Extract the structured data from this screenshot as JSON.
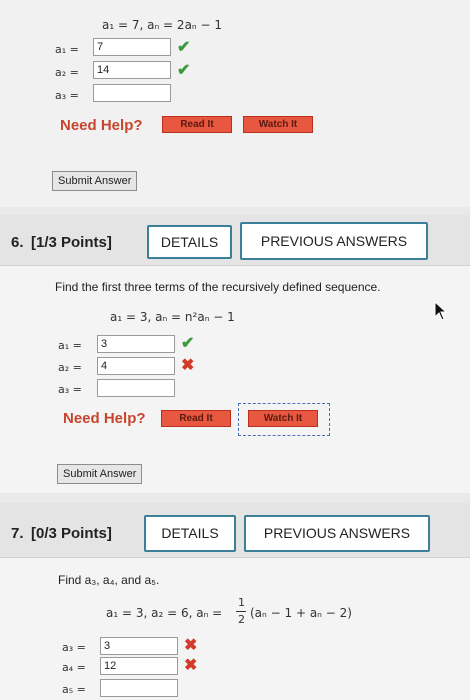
{
  "q5": {
    "formula": "a₁ = 7, aₙ = 2aₙ − 1",
    "terms": [
      {
        "label": "a₁ =",
        "value": "7",
        "status": "correct"
      },
      {
        "label": "a₂ =",
        "value": "14",
        "status": "correct"
      },
      {
        "label": "a₃ =",
        "value": "",
        "status": ""
      }
    ],
    "help_label": "Need Help?",
    "read_label": "Read It",
    "watch_label": "Watch It",
    "submit_label": "Submit Answer"
  },
  "q6": {
    "number": "6.",
    "points": "[1/3 Points]",
    "details_label": "DETAILS",
    "prev_label": "PREVIOUS ANSWERS",
    "prompt": "Find the first three terms of the recursively defined sequence.",
    "formula": "a₁ = 3, aₙ = n²aₙ − 1",
    "terms": [
      {
        "label": "a₁ =",
        "value": "3",
        "status": "correct"
      },
      {
        "label": "a₂ =",
        "value": "4",
        "status": "incorrect"
      },
      {
        "label": "a₃ =",
        "value": "",
        "status": ""
      }
    ],
    "help_label": "Need Help?",
    "read_label": "Read It",
    "watch_label": "Watch It",
    "submit_label": "Submit Answer"
  },
  "q7": {
    "number": "7.",
    "points": "[0/3 Points]",
    "details_label": "DETAILS",
    "prev_label": "PREVIOUS ANSWERS",
    "prompt": "Find a₃, a₄, and a₅.",
    "formula_left": "a₁ = 3, a₂ = 6, aₙ =",
    "formula_right": "(aₙ − 1 + aₙ − 2)",
    "frac_num": "1",
    "frac_den": "2",
    "terms": [
      {
        "label": "a₃ =",
        "value": "3",
        "status": "incorrect"
      },
      {
        "label": "a₄ =",
        "value": "12",
        "status": "incorrect"
      },
      {
        "label": "a₅ =",
        "value": "",
        "status": ""
      }
    ]
  },
  "marks": {
    "check": "✔",
    "cross": "✖"
  },
  "colors": {
    "help": "#c8452d",
    "check": "#3c9a3c",
    "cross": "#d23a2a",
    "details_border": "#3b7f99"
  }
}
